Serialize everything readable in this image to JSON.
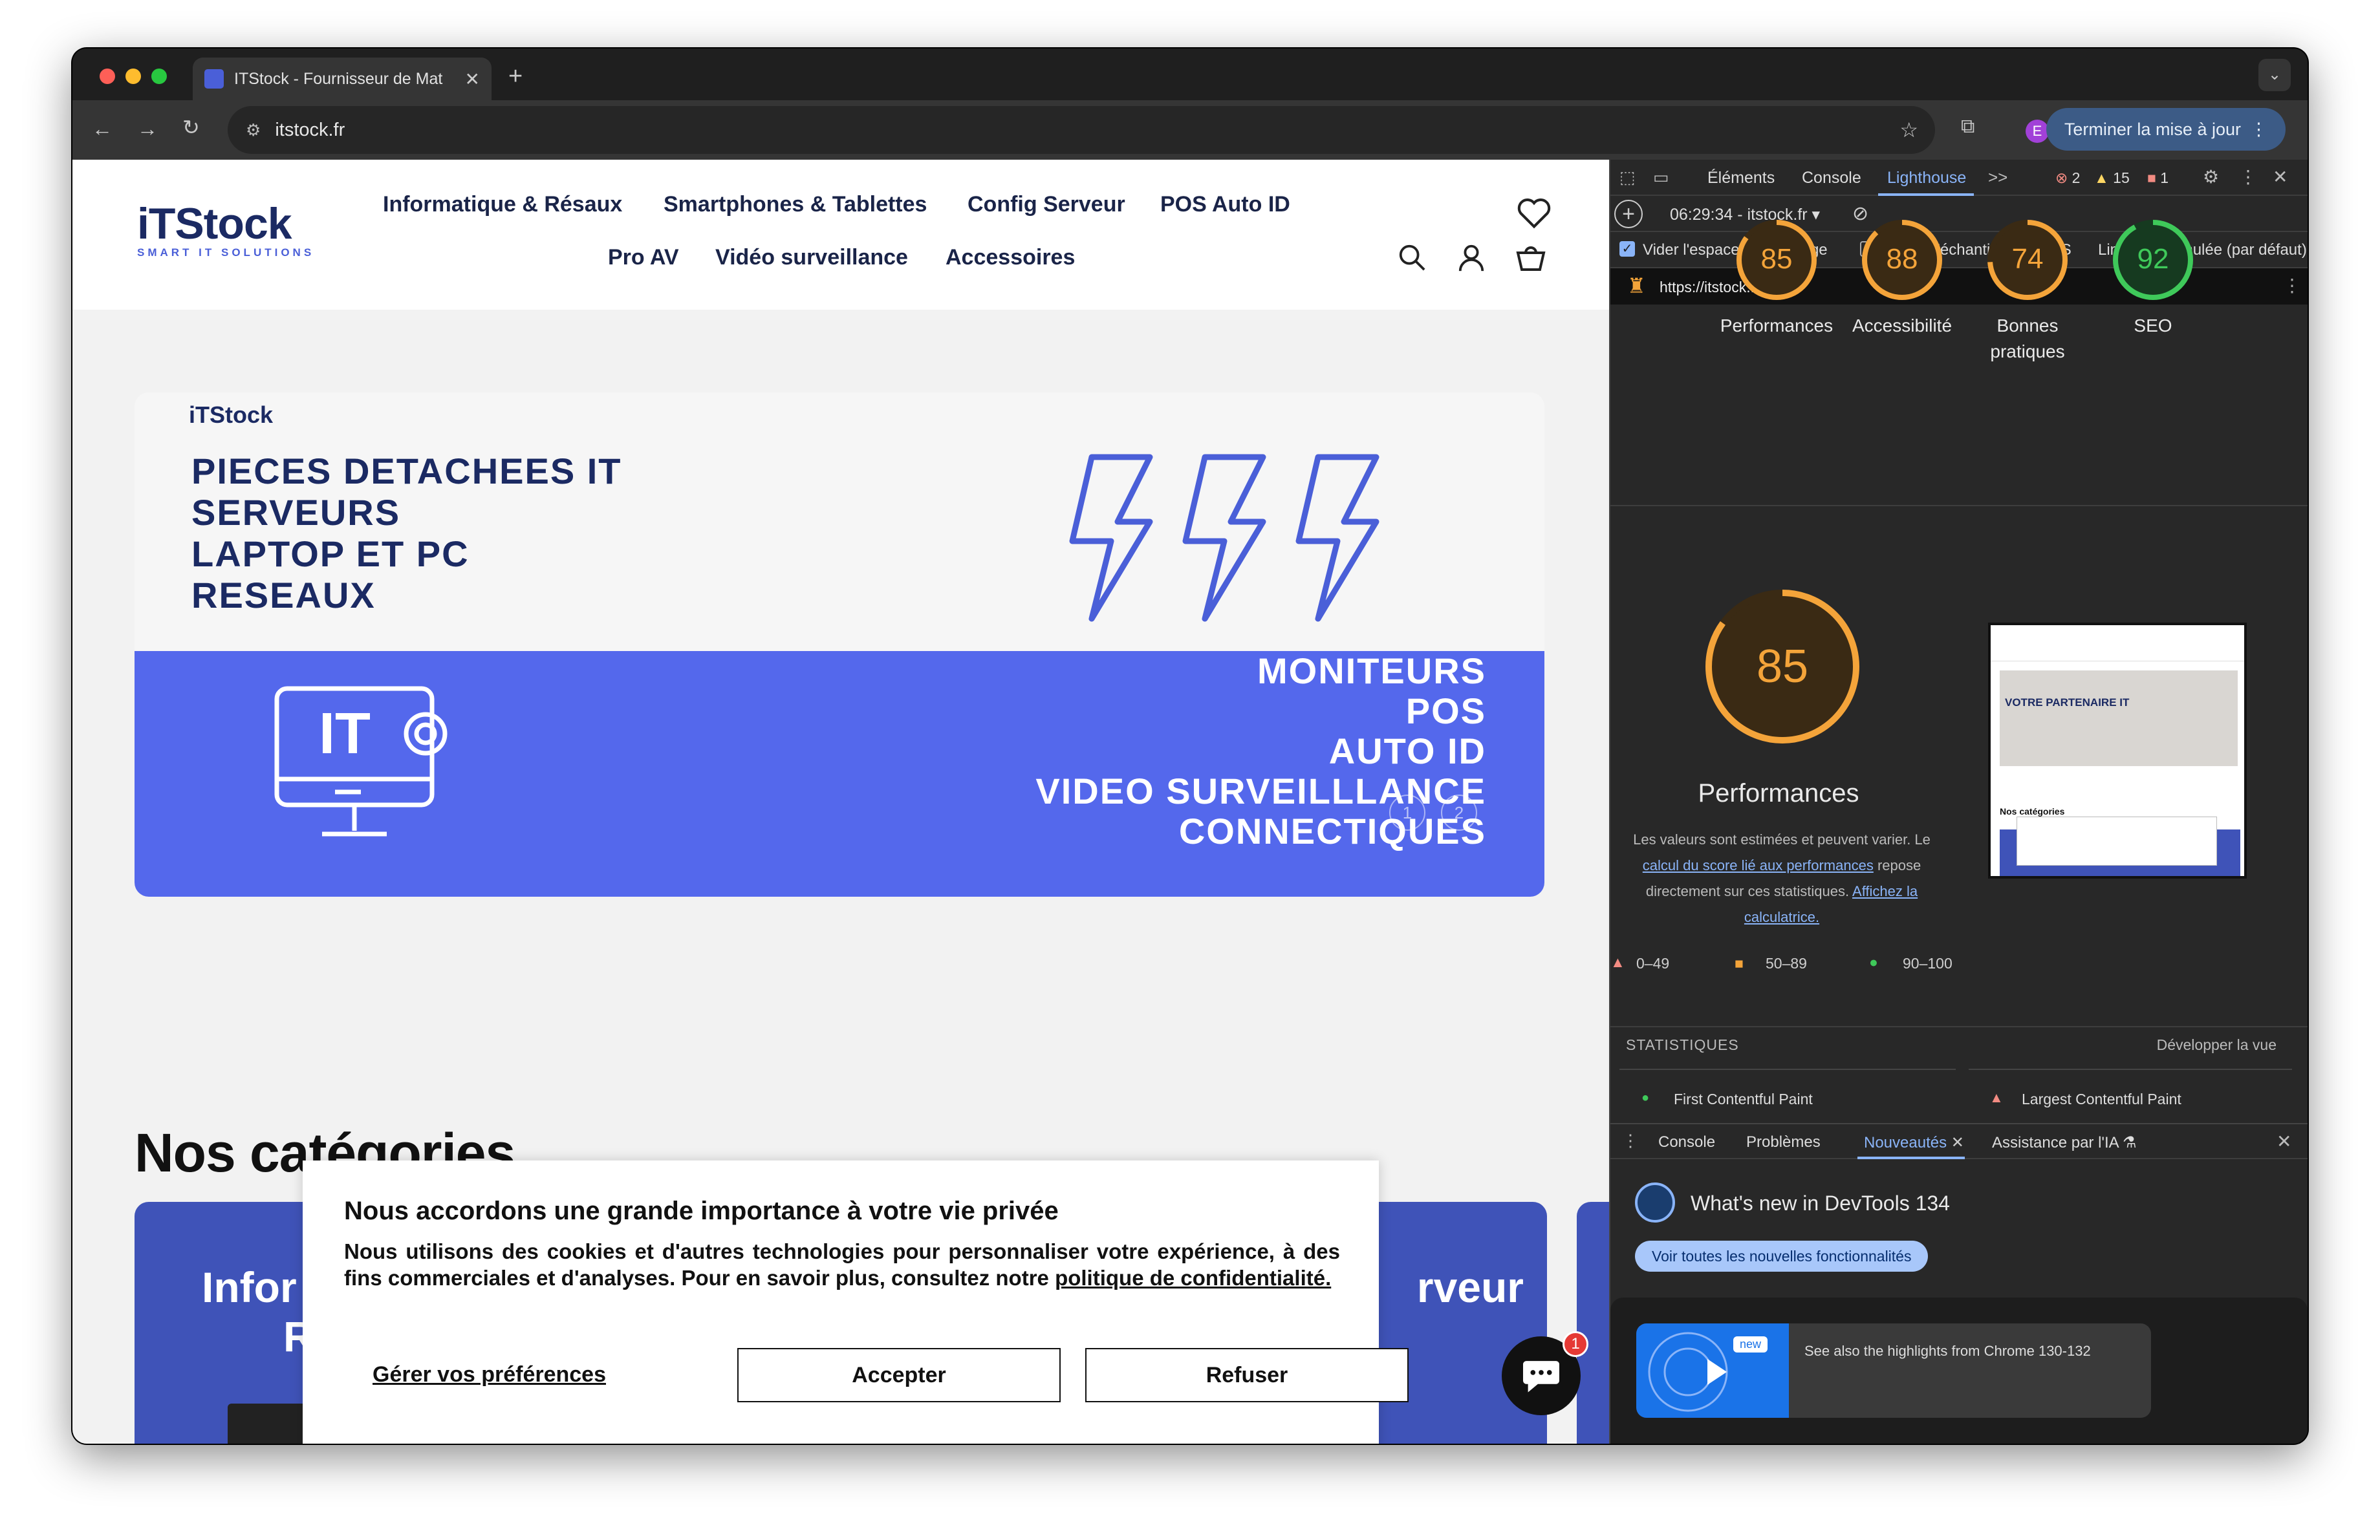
{
  "browser": {
    "tab_title": "ITStock - Fournisseur de Mat",
    "new_tab": "+",
    "url": "itstock.fr",
    "update_button": "Terminer la mise à jour",
    "profile_initial": "E"
  },
  "site": {
    "logo_main": "iTStock",
    "logo_sub": "SMART IT SOLUTIONS",
    "nav": [
      "Informatique & Résaux",
      "Smartphones & Tablettes",
      "Config Serveur",
      "POS Auto ID",
      "Pro AV",
      "Vidéo surveillance",
      "Accessoires"
    ],
    "hero": {
      "logo": "iTStock",
      "lines_left": [
        "PIECES DETACHEES IT",
        "SERVEURS",
        "LAPTOP ET PC",
        "RESEAUX"
      ],
      "lines_right": [
        "MONITEURS",
        "POS",
        "AUTO ID",
        "VIDEO SURVEILLLANCE",
        "CONNECTIQUES"
      ],
      "slide_dots": [
        "1",
        "2"
      ]
    },
    "categories_title": "Nos catégories",
    "card_left": "Infor",
    "card_left2": "R",
    "card_right": "rveur",
    "cookie": {
      "title": "Nous accordons une grande importance à votre vie privée",
      "body": "Nous utilisons des cookies et d'autres technologies pour personnaliser votre expérience, à des fins commerciales et d'analyses. Pour en savoir plus, consultez notre",
      "link": "politique de confidentialité.",
      "manage": "Gérer vos préférences",
      "accept": "Accepter",
      "refuse": "Refuser"
    },
    "chat_badge": "1"
  },
  "devtools": {
    "tabs": [
      "Éléments",
      "Console",
      "Lighthouse"
    ],
    "more": ">>",
    "errors": "2",
    "warnings": "15",
    "issues": "1",
    "report_select": "06:29:34 - itstock.fr",
    "opt_clear_storage": "Vider l'espace de stockage",
    "opt_js_sampling": "Activer l'échantillonnage JS",
    "opt_throttling": "Limitation simulée (par défaut)",
    "audit_url": "https://itstock.fr/",
    "scores": [
      {
        "value": 85,
        "label": "Performances",
        "color": "#f4a43a"
      },
      {
        "value": 88,
        "label": "Accessibilité",
        "color": "#f4a43a"
      },
      {
        "value": 74,
        "label": "Bonnes pratiques",
        "color": "#f4a43a"
      },
      {
        "value": 92,
        "label": "SEO",
        "color": "#3fc95a"
      }
    ],
    "main_score": 85,
    "main_label": "Performances",
    "desc_1": "Les valeurs sont estimées et peuvent varier. Le",
    "desc_link1": "calcul du score lié aux performances",
    "desc_2": "repose directement sur ces statistiques.",
    "desc_link2": "Affichez la calculatrice.",
    "legend": [
      "0–49",
      "50–89",
      "90–100"
    ],
    "stats_title": "STATISTIQUES",
    "expand": "Développer la vue",
    "metrics": [
      "First Contentful Paint",
      "Largest Contentful Paint"
    ],
    "drawer_tabs": [
      "Console",
      "Problèmes",
      "Nouveautés",
      "Assistance par l'IA"
    ],
    "whats_new": "What's new in DevTools 134",
    "see_all": "Voir toutes les nouvelles fonctionnalités",
    "new_badge": "new",
    "highlights": "See also the highlights from Chrome 130-132",
    "thumb": {
      "partner": "VOTRE PARTENAIRE IT",
      "cats": "Nos catégories"
    }
  }
}
